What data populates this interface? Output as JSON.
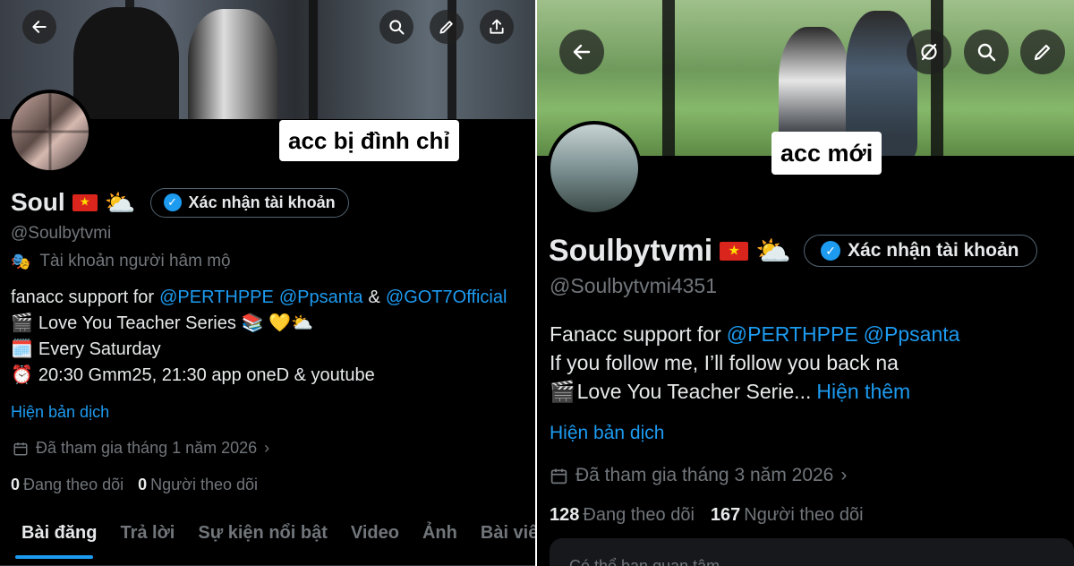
{
  "left": {
    "stamp": "acc bị đình chỉ",
    "name": "Soul",
    "flag": "vietnam-flag",
    "weather": "⛅",
    "verify_label": "Xác nhận tài khoản",
    "handle": "@Soulbytvmi",
    "account_type": "Tài khoản người hâm mộ",
    "bio": {
      "line1_text": "fanacc support for",
      "mention1": "@PERTHPPE",
      "mention2": "@Ppsanta",
      "amp": "&",
      "mention3": "@GOT7Official",
      "line2_emoji": "🎬",
      "line2_text": "Love You Teacher Series",
      "line2_tail": "📚 💛⛅",
      "line3_emoji": "🗓️",
      "line3_text": "Every Saturday",
      "line4_emoji": "⏰",
      "line4_text": "20:30 Gmm25, 21:30 app oneD & youtube"
    },
    "translate": "Hiện bản dịch",
    "joined": "Đã tham gia tháng 1 năm 2026",
    "following_count": "0",
    "following_label": "Đang theo dõi",
    "followers_count": "0",
    "followers_label": "Người theo dõi",
    "tabs": [
      "Bài đăng",
      "Trả lời",
      "Sự kiện nổi bật",
      "Video",
      "Ảnh",
      "Bài viết"
    ]
  },
  "right": {
    "stamp": "acc mới",
    "name": "Soulbytvmi",
    "flag": "vietnam-flag",
    "weather": "⛅",
    "verify_label": "Xác nhận tài khoản",
    "handle": "@Soulbytvmi4351",
    "bio": {
      "line1_text": "Fanacc support for",
      "mention1": "@PERTHPPE",
      "mention2": "@Ppsanta",
      "line2_text": "If you follow me, I’ll follow you back na",
      "line3_emoji": "🎬",
      "line3_text": "Love You Teacher Serie...",
      "show_more": "Hiện thêm"
    },
    "translate": "Hiện bản dịch",
    "joined": "Đã tham gia tháng 3 năm 2026",
    "following_count": "128",
    "following_label": "Đang theo dõi",
    "followers_count": "167",
    "followers_label": "Người theo dõi",
    "bottom_hint": "Có thể bạn quan tâm"
  },
  "colors": {
    "accent": "#1d9bf0",
    "background": "#000000",
    "muted": "#71767b",
    "text": "#e7e9ea"
  }
}
